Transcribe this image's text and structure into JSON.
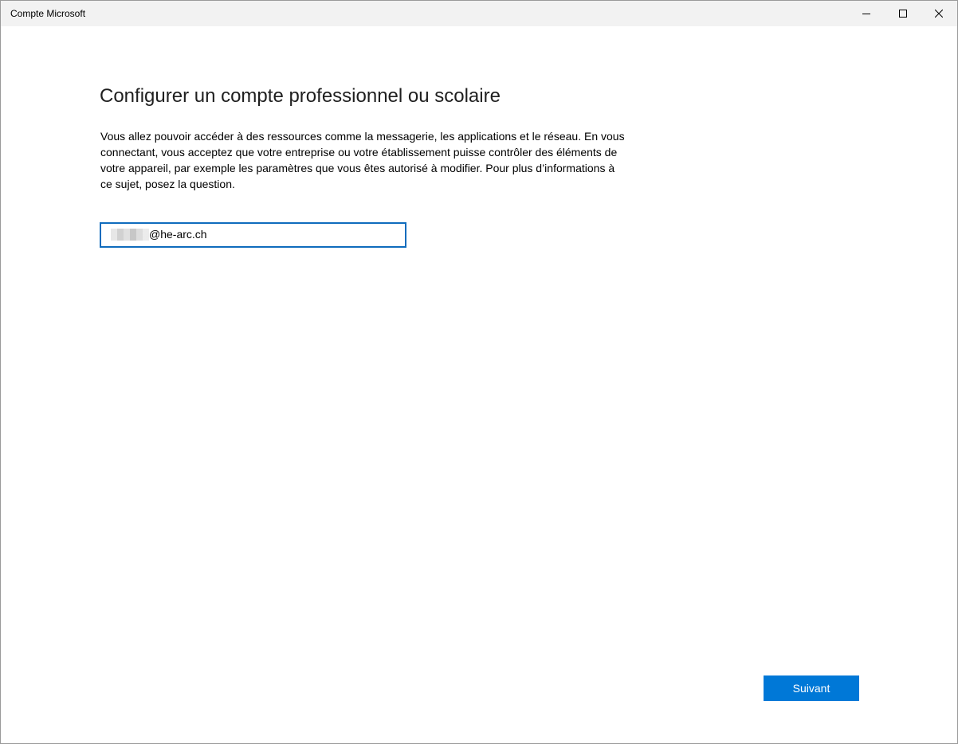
{
  "window": {
    "title": "Compte Microsoft",
    "controls": {
      "minimize_icon": "minimize-icon",
      "maximize_icon": "maximize-icon",
      "close_icon": "close-icon"
    }
  },
  "main": {
    "heading": "Configurer un compte professionnel ou scolaire",
    "description": "Vous allez pouvoir accéder à des ressources comme la messagerie, les applications et le réseau. En vous connectant, vous acceptez que votre entreprise ou votre établissement puisse contrôler des éléments de votre appareil, par exemple les paramètres que vous êtes autorisé à modifier. Pour plus d’informations à ce sujet, posez la question.",
    "email_field": {
      "value_visible": "@he-arc.ch"
    },
    "next_label": "Suivant"
  },
  "colors": {
    "accent": "#0078d7",
    "field_border": "#0f6cbd",
    "titlebar": "#f2f2f2"
  }
}
